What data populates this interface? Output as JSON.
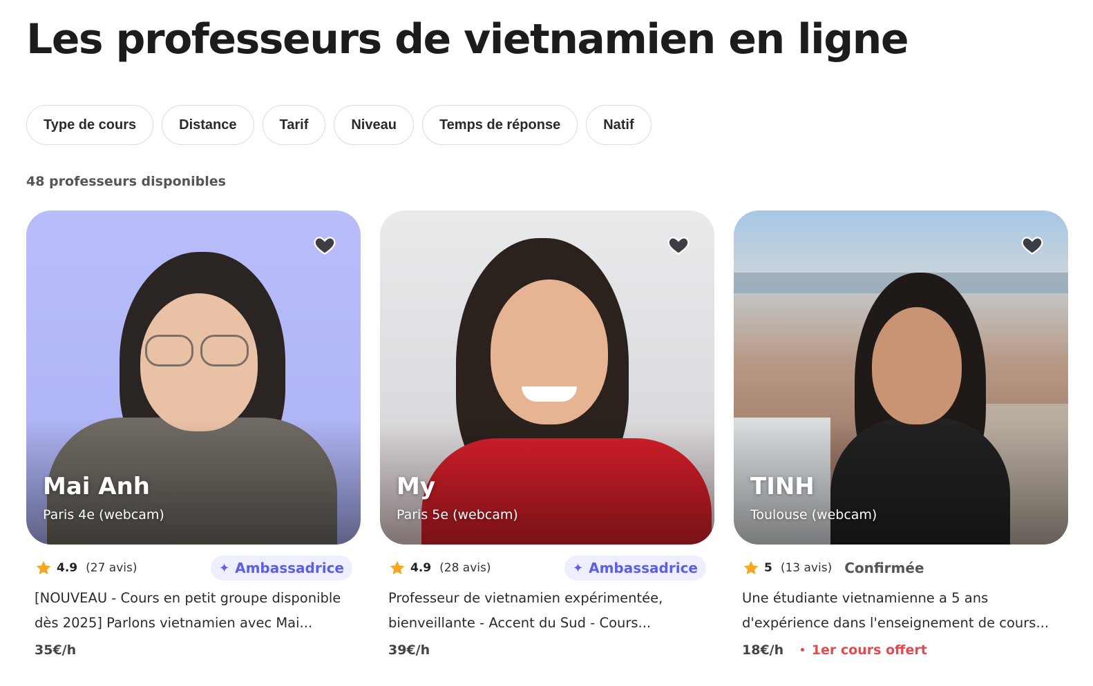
{
  "page": {
    "title": "Les professeurs de vietnamien en ligne"
  },
  "filters": [
    "Type de cours",
    "Distance",
    "Tarif",
    "Niveau",
    "Temps de réponse",
    "Natif"
  ],
  "results": {
    "count_label": "48 professeurs disponibles"
  },
  "colors": {
    "accent": "#5b5ee6",
    "badge_bg": "#eeeffe",
    "star": "#f5a623",
    "offer": "#e5484d"
  },
  "teachers": [
    {
      "name": "Mai Anh",
      "location": "Paris 4e (webcam)",
      "rating": "4.9",
      "reviews": "(27 avis)",
      "badge": "Ambassadrice",
      "description_line1": "[NOUVEAU - Cours en petit groupe disponible",
      "description_line2": "dès 2025] Parlons vietnamien avec Mai...",
      "price": "35€/h",
      "favorite_icon": "heart-icon"
    },
    {
      "name": "My",
      "location": "Paris 5e (webcam)",
      "rating": "4.9",
      "reviews": "(28 avis)",
      "badge": "Ambassadrice",
      "description_line1": "Professeur de vietnamien expérimentée,",
      "description_line2": "bienveillante - Accent du Sud - Cours...",
      "price": "39€/h",
      "favorite_icon": "heart-icon"
    },
    {
      "name": "TINH",
      "location": "Toulouse (webcam)",
      "rating": "5",
      "reviews": "(13 avis)",
      "level": "Confirmée",
      "description_line1": "Une étudiante vietnamienne a 5 ans",
      "description_line2": "d'expérience dans l'enseignement de cours...",
      "price": "18€/h",
      "offer": "1er cours offert",
      "favorite_icon": "heart-icon"
    }
  ]
}
